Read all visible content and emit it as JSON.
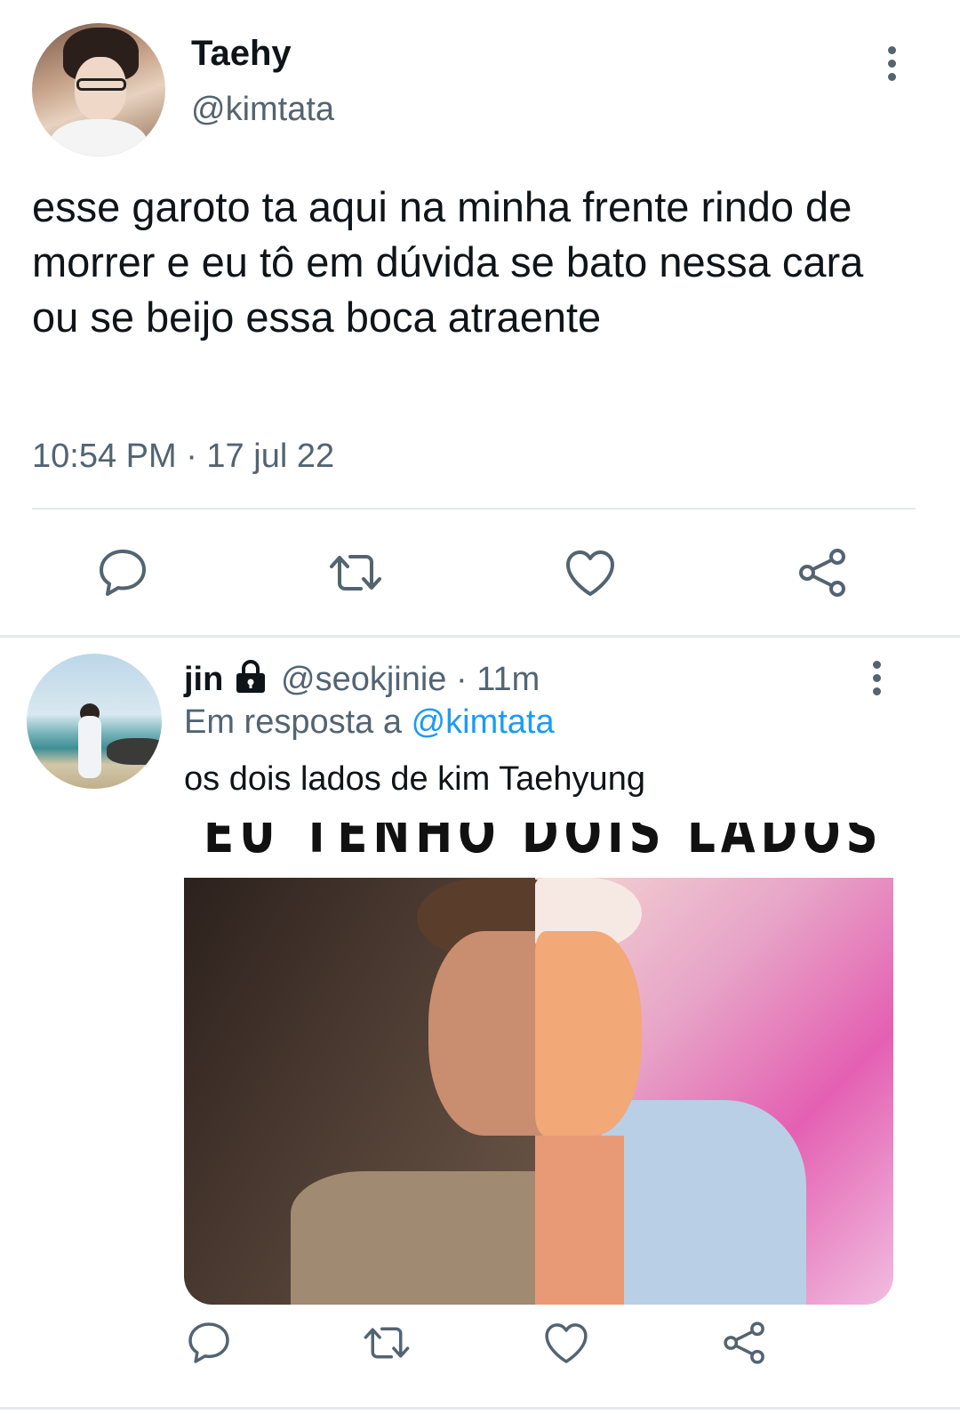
{
  "main_tweet": {
    "display_name": "Taehy",
    "handle": "@kimtata",
    "text": "esse garoto ta aqui na minha frente rindo de morrer e eu tô em dúvida se bato nessa cara ou se beijo essa boca atraente",
    "timestamp": "10:54 PM · 17 jul 22"
  },
  "reply_tweet": {
    "display_name": "jin",
    "handle_time": "@seokjinie · 11m",
    "in_reply_prefix": "Em resposta a",
    "in_reply_mention": "@kimtata",
    "text": "os dois lados de kim Taehyung",
    "media_caption": "EU TENHO DOIS LADOS"
  },
  "icons": {
    "reply": "speech-bubble-icon",
    "retweet": "retweet-icon",
    "like": "heart-icon",
    "share": "share-icon",
    "more": "more-vertical-icon",
    "protected": "lock-icon"
  },
  "colors": {
    "text_primary": "#0f1419",
    "text_secondary": "#536471",
    "accent_blue": "#1d9bf0",
    "divider": "#e6e9eb"
  }
}
